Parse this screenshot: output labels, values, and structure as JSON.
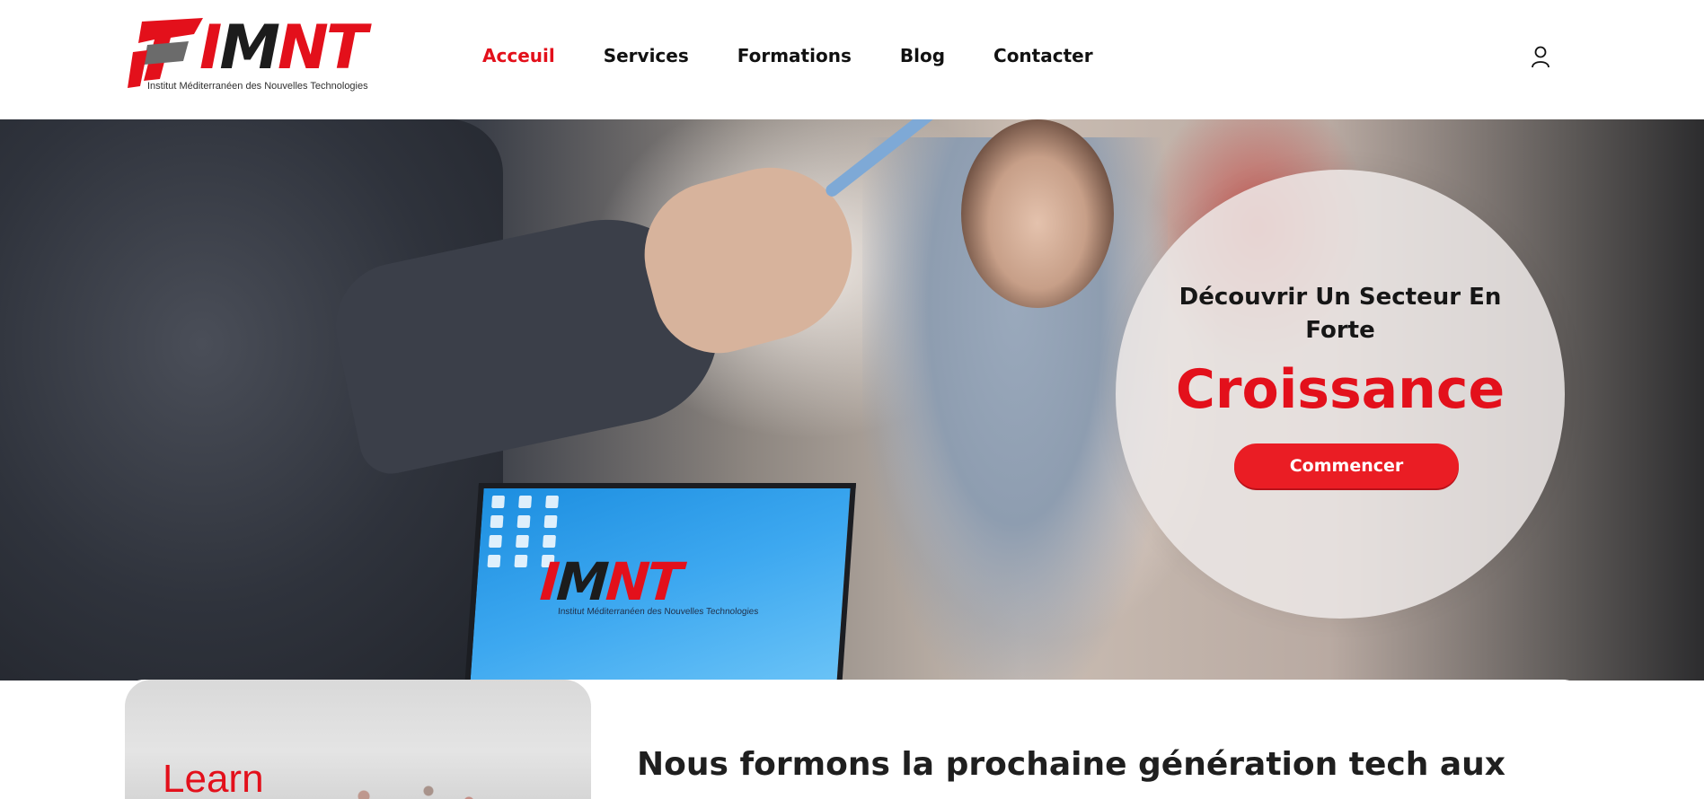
{
  "brand": {
    "logo_text_i": "I",
    "logo_text_m": "M",
    "logo_text_nt": "NT",
    "tagline": "Institut Méditerranéen des Nouvelles Technologies",
    "colors": {
      "primary": "#e3101b",
      "dark": "#1c1c1c"
    }
  },
  "nav": {
    "items": [
      {
        "label": "Acceuil",
        "active": true
      },
      {
        "label": "Services",
        "active": false
      },
      {
        "label": "Formations",
        "active": false
      },
      {
        "label": "Blog",
        "active": false
      },
      {
        "label": "Contacter",
        "active": false
      }
    ],
    "user_icon": "user-icon"
  },
  "hero": {
    "lead": "Découvrir Un Secteur En Forte",
    "highlight": "Croissance",
    "cta_label": "Commencer",
    "laptop_logo_i": "I",
    "laptop_logo_m": "M",
    "laptop_logo_nt": "NT",
    "laptop_tagline": "Institut Méditerranéen des Nouvelles Technologies"
  },
  "feature": {
    "image_text": "Learn",
    "heading": "Nous formons la prochaine génération tech aux"
  }
}
